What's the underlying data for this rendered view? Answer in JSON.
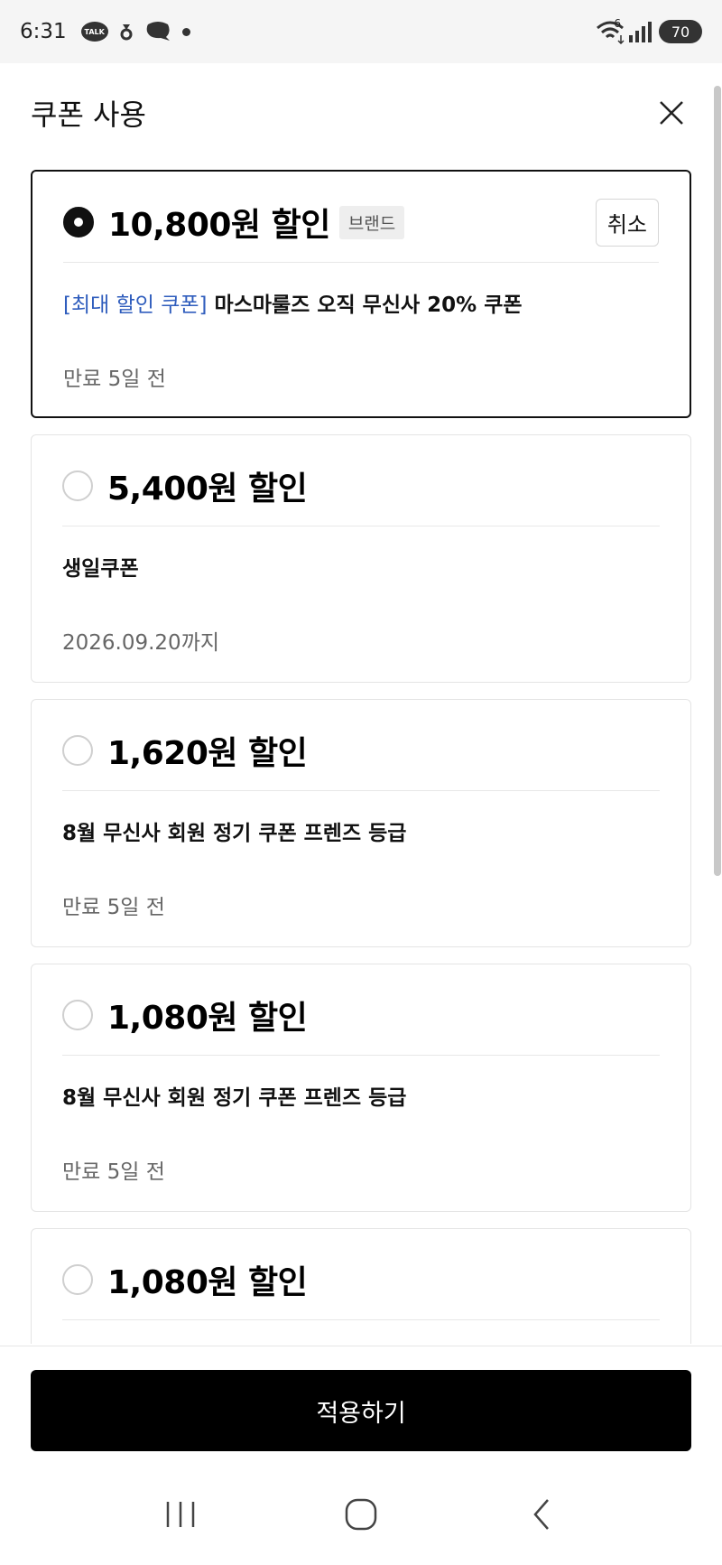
{
  "status_bar": {
    "time": "6:31",
    "talk_label": "TALK",
    "network_label": "6",
    "battery": "70"
  },
  "header": {
    "title": "쿠폰 사용",
    "close_icon": "close-icon"
  },
  "coupons": [
    {
      "amount": "10,800원 할인",
      "badge": "브랜드",
      "cancel_label": "취소",
      "selected": true,
      "tag": "[최대 할인 쿠폰]",
      "name": " 마스마룰즈 오직 무신사 20% 쿠폰",
      "expiry": "만료 5일 전"
    },
    {
      "amount": "5,400원 할인",
      "selected": false,
      "name": "생일쿠폰",
      "expiry": "2026.09.20까지"
    },
    {
      "amount": "1,620원 할인",
      "selected": false,
      "name": "8월 무신사 회원 정기 쿠폰 프렌즈 등급",
      "expiry": "만료 5일 전"
    },
    {
      "amount": "1,080원 할인",
      "selected": false,
      "name": "8월 무신사 회원 정기 쿠폰 프렌즈 등급",
      "expiry": "만료 5일 전"
    },
    {
      "amount": "1,080원 할인",
      "selected": false
    }
  ],
  "footer": {
    "apply_label": "적용하기"
  },
  "colors": {
    "accent_link": "#2f5dbd",
    "primary_button": "#000000"
  }
}
